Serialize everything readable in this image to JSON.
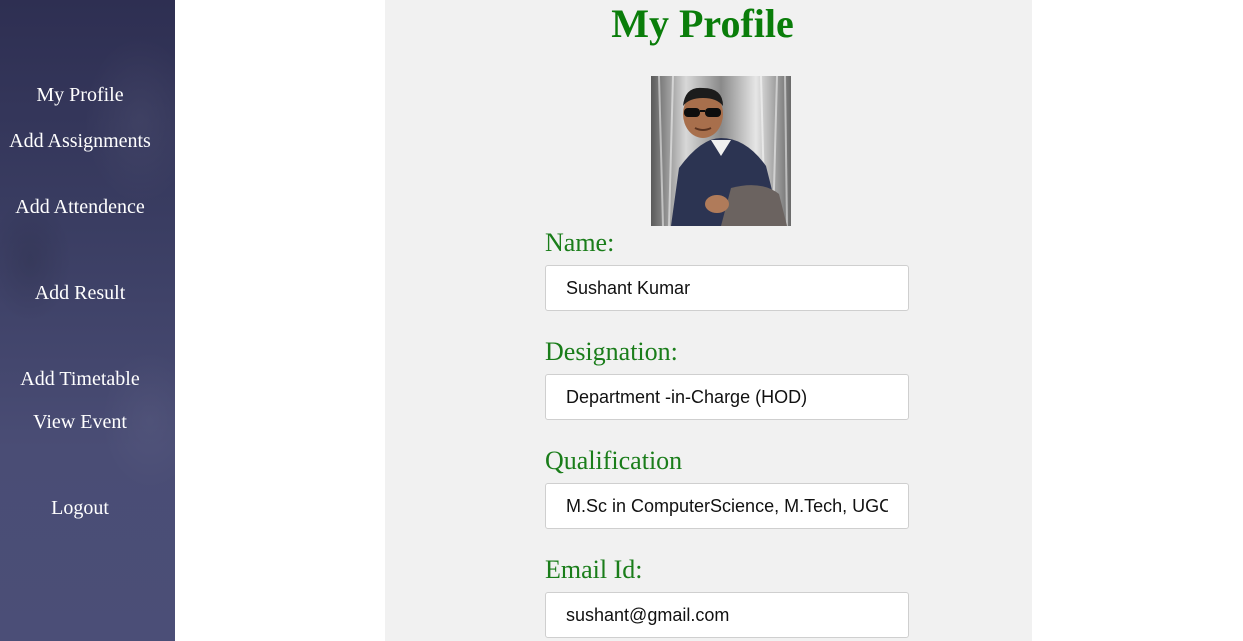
{
  "sidebar": {
    "items": [
      {
        "label": "My Profile"
      },
      {
        "label": "Add Assignments"
      },
      {
        "label": "Add Attendence"
      },
      {
        "label": "Add Result"
      },
      {
        "label": "Add Timetable"
      },
      {
        "label": "View Event"
      },
      {
        "label": "Logout"
      }
    ]
  },
  "main": {
    "title": "My Profile",
    "fields": [
      {
        "label": "Name:",
        "value": "Sushant Kumar"
      },
      {
        "label": "Designation:",
        "value": "Department -in-Charge (HOD)"
      },
      {
        "label": "Qualification",
        "value": "M.Sc in ComputerScience, M.Tech, UGC"
      },
      {
        "label": "Email Id:",
        "value": "sushant@gmail.com"
      }
    ]
  },
  "colors": {
    "sidebar_bg": "#3a3d62",
    "title_green": "#0a7d0a",
    "label_green": "#1a7d1a",
    "content_bg": "#f1f1f1"
  }
}
